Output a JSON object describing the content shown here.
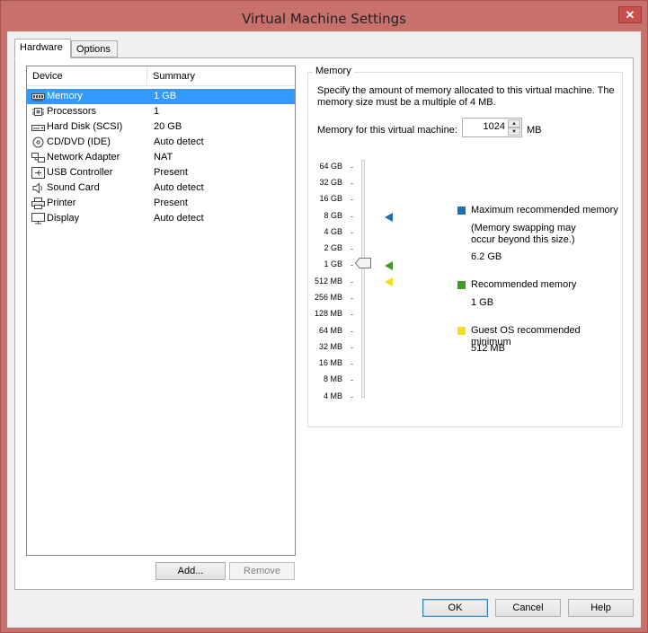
{
  "window": {
    "title": "Virtual Machine Settings",
    "close_glyph": "✕"
  },
  "tabs": [
    {
      "label": "Hardware",
      "active": true
    },
    {
      "label": "Options",
      "active": false
    }
  ],
  "device_list": {
    "columns": [
      "Device",
      "Summary"
    ],
    "rows": [
      {
        "name": "Memory",
        "summary": "1 GB",
        "icon": "memory-icon",
        "selected": true
      },
      {
        "name": "Processors",
        "summary": "1",
        "icon": "processor-icon"
      },
      {
        "name": "Hard Disk (SCSI)",
        "summary": "20 GB",
        "icon": "hard-disk-icon"
      },
      {
        "name": "CD/DVD (IDE)",
        "summary": "Auto detect",
        "icon": "cd-dvd-icon"
      },
      {
        "name": "Network Adapter",
        "summary": "NAT",
        "icon": "network-adapter-icon"
      },
      {
        "name": "USB Controller",
        "summary": "Present",
        "icon": "usb-controller-icon"
      },
      {
        "name": "Sound Card",
        "summary": "Auto detect",
        "icon": "sound-card-icon"
      },
      {
        "name": "Printer",
        "summary": "Present",
        "icon": "printer-icon"
      },
      {
        "name": "Display",
        "summary": "Auto detect",
        "icon": "display-icon"
      }
    ],
    "add_label": "Add...",
    "remove_label": "Remove"
  },
  "memory": {
    "group_title": "Memory",
    "description": "Specify the amount of memory allocated to this virtual machine. The memory size must be a multiple of 4 MB.",
    "field_label": "Memory for this virtual machine:",
    "value": "1024",
    "unit": "MB",
    "scale": [
      "64 GB",
      "32 GB",
      "16 GB",
      "8 GB",
      "4 GB",
      "2 GB",
      "1 GB",
      "512 MB",
      "256 MB",
      "128 MB",
      "64 MB",
      "32 MB",
      "16 MB",
      "8 MB",
      "4 MB"
    ],
    "legend": [
      {
        "label": "Maximum recommended memory",
        "note": "(Memory swapping may occur beyond this size.)",
        "value": "6.2 GB",
        "color": "#1a6fb5"
      },
      {
        "label": "Recommended memory",
        "value": "1 GB",
        "color": "#3f9b27"
      },
      {
        "label": "Guest OS recommended minimum",
        "value": "512 MB",
        "color": "#f0e020"
      }
    ]
  },
  "footer": {
    "ok_label": "OK",
    "cancel_label": "Cancel",
    "help_label": "Help"
  }
}
